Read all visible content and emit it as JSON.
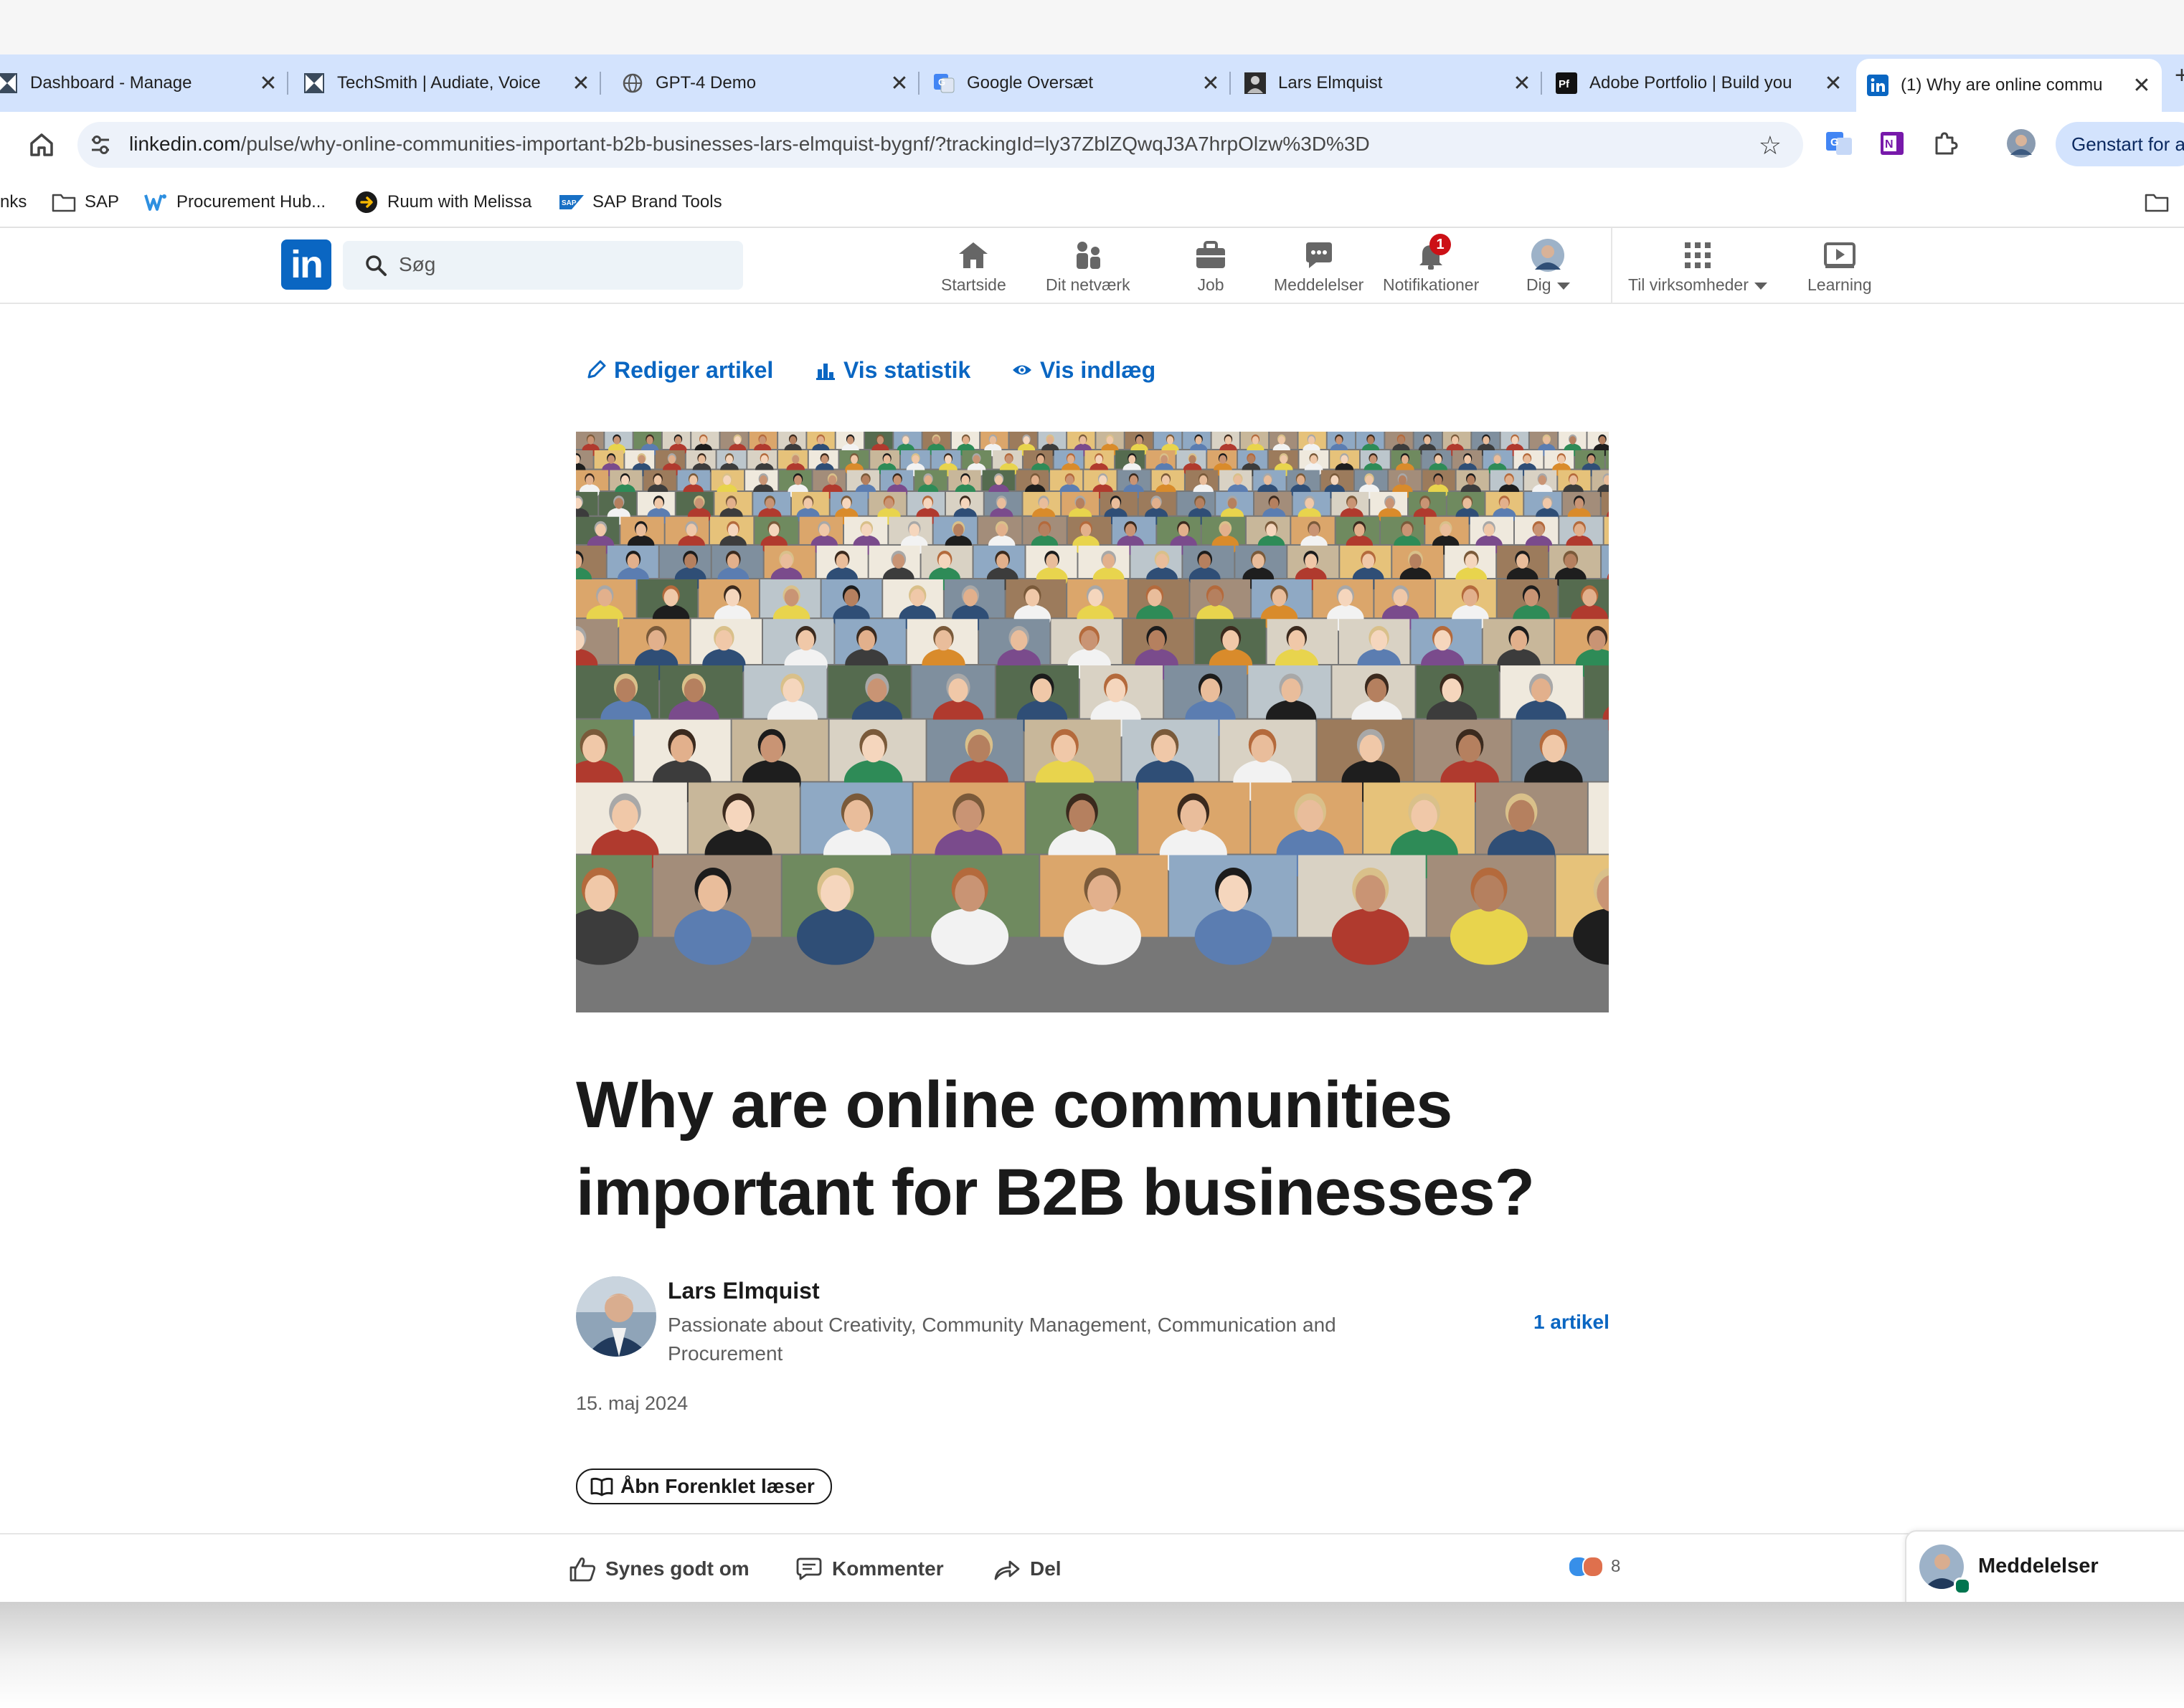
{
  "browser": {
    "tabs": [
      {
        "title": "Dashboard - Manage",
        "favicon": "techsmith-icon"
      },
      {
        "title": "TechSmith | Audiate, Voice",
        "favicon": "techsmith-icon"
      },
      {
        "title": "GPT-4 Demo",
        "favicon": "globe-icon"
      },
      {
        "title": "Google Oversæt",
        "favicon": "google-translate-icon"
      },
      {
        "title": "Lars Elmquist",
        "favicon": "profile-icon"
      },
      {
        "title": "Adobe Portfolio | Build you",
        "favicon": "adobe-portfolio-icon",
        "favicon_text": "Pf"
      },
      {
        "title": "(1) Why are online commu",
        "favicon": "linkedin-icon",
        "active": true
      }
    ],
    "close_glyph": "✕",
    "new_tab_glyph": "+",
    "url": {
      "host": "linkedin.com",
      "path": "/pulse/why-online-communities-important-b2b-businesses-lars-elmquist-bygnf/?trackingId=ly37ZblZQwqJ3A7hrpOlzw%3D%3D"
    },
    "restart_button": "Genstart for at opdatere",
    "bookmarks": [
      {
        "label": "nks",
        "icon": ""
      },
      {
        "label": "SAP",
        "icon": "folder-icon"
      },
      {
        "label": "Procurement Hub...",
        "icon": "procurement-hub-icon"
      },
      {
        "label": "Ruum with Melissa",
        "icon": "ruum-icon"
      },
      {
        "label": "SAP Brand Tools",
        "icon": "sap-icon"
      }
    ]
  },
  "linkedin": {
    "logo": "in",
    "search_placeholder": "Søg",
    "nav": [
      {
        "label": "Startside",
        "icon": "home-icon"
      },
      {
        "label": "Dit netværk",
        "icon": "network-icon"
      },
      {
        "label": "Job",
        "icon": "briefcase-icon"
      },
      {
        "label": "Meddelelser",
        "icon": "messaging-icon"
      },
      {
        "label": "Notifikationer",
        "icon": "bell-icon",
        "badge": "1"
      },
      {
        "label": "Dig",
        "icon": "avatar"
      },
      {
        "label": "Til virksomheder",
        "icon": "grid-icon"
      },
      {
        "label": "Learning",
        "icon": "learning-icon"
      }
    ]
  },
  "article": {
    "actions": [
      {
        "label": "Rediger artikel",
        "icon": "pencil-icon"
      },
      {
        "label": "Vis statistik",
        "icon": "bar-chart-icon"
      },
      {
        "label": "Vis indlæg",
        "icon": "eye-icon"
      }
    ],
    "title": "Why are online communities important for B2B businesses?",
    "author": {
      "name": "Lars Elmquist",
      "tagline": "Passionate about Creativity, Community Management, Communication and Procurement",
      "articles": "1 artikel"
    },
    "date": "15. maj 2024",
    "reader_button": "Åbn Forenklet læser"
  },
  "social_bar": {
    "like": "Synes godt om",
    "comment": "Kommenter",
    "share": "Del",
    "reaction_count": "8",
    "messaging_widget": "Meddelelser"
  },
  "colors": {
    "linkedin_blue": "#0a66c2",
    "tab_strip": "#d3e3fd",
    "badge_red": "#cc1016",
    "text_dark": "#1a1a1a",
    "text_muted": "#5e5e5e"
  }
}
